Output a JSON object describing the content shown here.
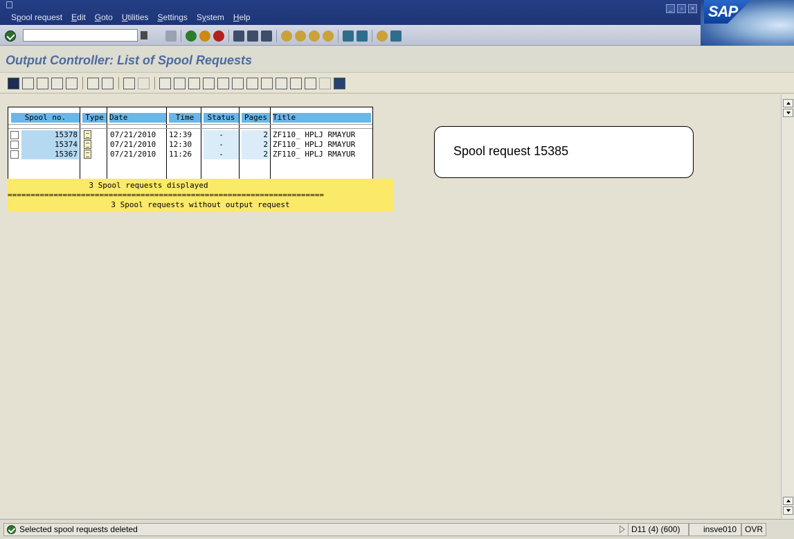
{
  "menubar": {
    "items": [
      {
        "label": "Spool request",
        "u": "p"
      },
      {
        "label": "Edit",
        "u": "E"
      },
      {
        "label": "Goto",
        "u": "G"
      },
      {
        "label": "Utilities",
        "u": "U"
      },
      {
        "label": "Settings",
        "u": "S"
      },
      {
        "label": "System",
        "u": "y"
      },
      {
        "label": "Help",
        "u": "H"
      }
    ]
  },
  "logo": {
    "text": "SAP"
  },
  "command_field": {
    "value": ""
  },
  "title": "Output Controller: List of Spool Requests",
  "table": {
    "headers": {
      "spool_no": "Spool no.",
      "type": "Type",
      "date": "Date",
      "time": "Time",
      "status": "Status",
      "pages": "Pages",
      "title": "Title"
    },
    "rows": [
      {
        "spool_no": "15378",
        "date": "07/21/2010",
        "time": "12:39",
        "status": "-",
        "pages": "2",
        "title": "ZF110_ HPLJ RMAYUR"
      },
      {
        "spool_no": "15374",
        "date": "07/21/2010",
        "time": "12:30",
        "status": "-",
        "pages": "2",
        "title": "ZF110_ HPLJ RMAYUR"
      },
      {
        "spool_no": "15367",
        "date": "07/21/2010",
        "time": "11:26",
        "status": "-",
        "pages": "2",
        "title": "ZF110_ HPLJ RMAYUR"
      }
    ]
  },
  "summary": {
    "line1": "3 Spool requests displayed",
    "divider": "=====================================================================",
    "line2": "3 Spool requests without output request"
  },
  "callout": "Spool request 15385",
  "status": {
    "message": "Selected spool requests deleted",
    "system": "D11 (4) (600)",
    "server": "insve010",
    "mode": "OVR"
  },
  "colors": {
    "menubar": "#243f86",
    "header_cell": "#69b7e8",
    "summary_bg": "#fbe968",
    "title_text": "#4d6aa3"
  }
}
